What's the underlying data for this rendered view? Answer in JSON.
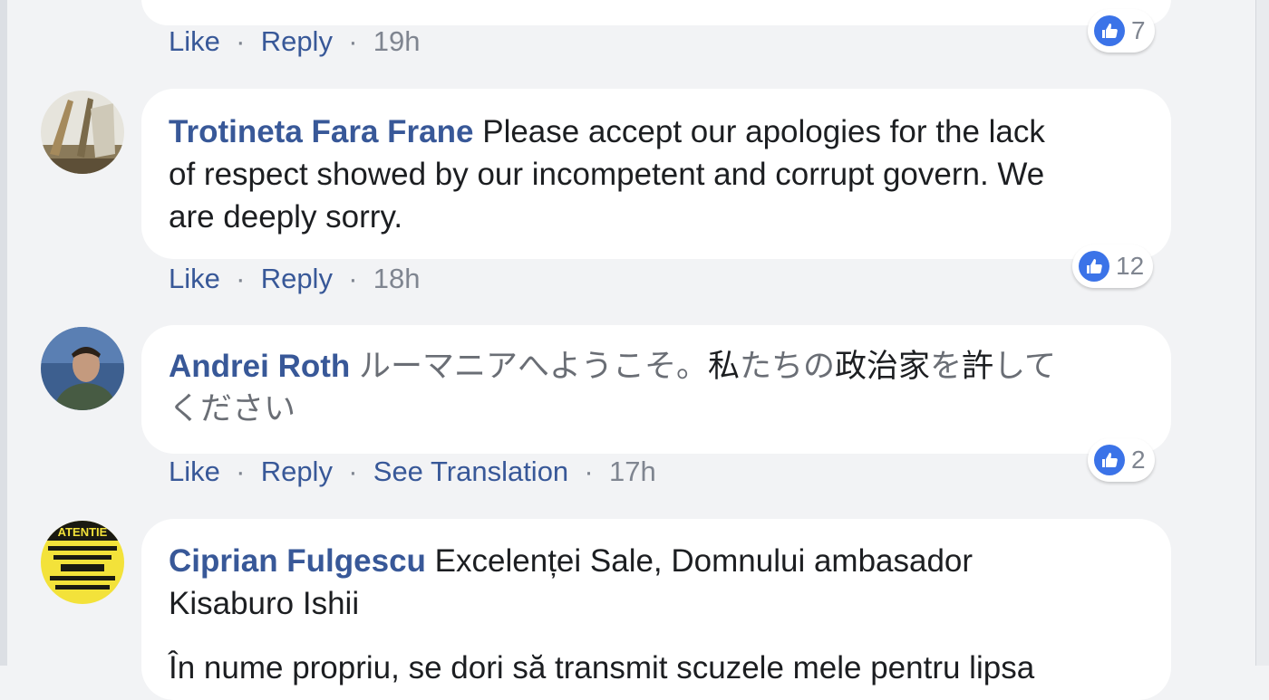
{
  "comments": [
    {
      "actions": {
        "like": "Like",
        "reply": "Reply",
        "time": "19h"
      },
      "reaction_count": "7"
    },
    {
      "author": "Trotineta Fara Frane",
      "text_line1": "Please accept our apologies for the lack",
      "text_line2": "of respect showed by our incompetent and corrupt govern. We",
      "text_line3": "are deeply sorry.",
      "actions": {
        "like": "Like",
        "reply": "Reply",
        "time": "18h"
      },
      "reaction_count": "12"
    },
    {
      "author": "Andrei Roth",
      "text_line1_a": "ルーマニアへようこそ。",
      "text_line1_b": "私",
      "text_line1_c": "たちの",
      "text_line1_d": "政治家",
      "text_line1_e": "を",
      "text_line1_f": "許",
      "text_line1_g": "して",
      "text_line2": "ください",
      "actions": {
        "like": "Like",
        "reply": "Reply",
        "translate": "See Translation",
        "time": "17h"
      },
      "reaction_count": "2"
    },
    {
      "author": "Ciprian Fulgescu",
      "text_line1": "Excelenței Sale, Domnului ambasador",
      "text_line2": "Kisaburo Ishii",
      "text_line3": "În nume propriu, se dori să transmit scuzele mele pentru lipsa"
    }
  ],
  "reaction_type": "like-icon",
  "colors": {
    "author": "#385898",
    "like_badge": "#3b73e8",
    "bubble": "#ffffff",
    "page_bg": "#f2f3f5"
  },
  "avatar4_text": {
    "line1": "ATENTIE"
  }
}
